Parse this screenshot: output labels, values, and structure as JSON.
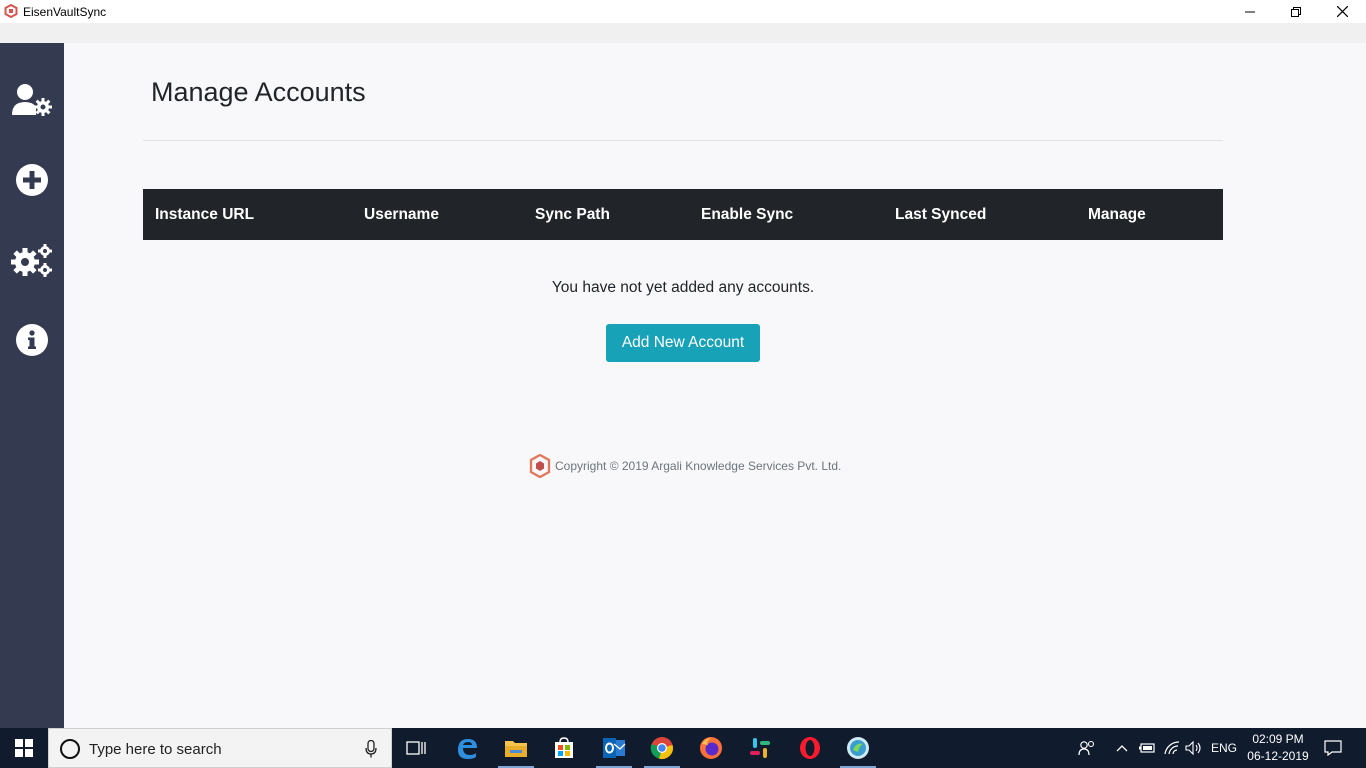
{
  "window": {
    "title": "EisenVaultSync"
  },
  "sidebar": {
    "items": [
      {
        "name": "manage-accounts",
        "icon": "user-gear-icon"
      },
      {
        "name": "add-account",
        "icon": "plus-circle-icon"
      },
      {
        "name": "settings",
        "icon": "gears-icon"
      },
      {
        "name": "about",
        "icon": "info-circle-icon"
      }
    ]
  },
  "main": {
    "title": "Manage Accounts",
    "table": {
      "columns": [
        "Instance URL",
        "Username",
        "Sync Path",
        "Enable Sync",
        "Last Synced",
        "Manage"
      ],
      "rows": []
    },
    "empty_message": "You have not yet added any accounts.",
    "add_button_label": "Add New Account",
    "footer": "Copyright © 2019 Argali Knowledge Services Pvt. Ltd."
  },
  "taskbar": {
    "search_placeholder": "Type here to search",
    "language": "ENG",
    "time": "02:09 PM",
    "date": "06-12-2019"
  },
  "colors": {
    "sidebar_bg": "#343a4f",
    "table_header_bg": "#212529",
    "primary_button": "#17a2b8",
    "taskbar_bg": "#101b2d"
  }
}
